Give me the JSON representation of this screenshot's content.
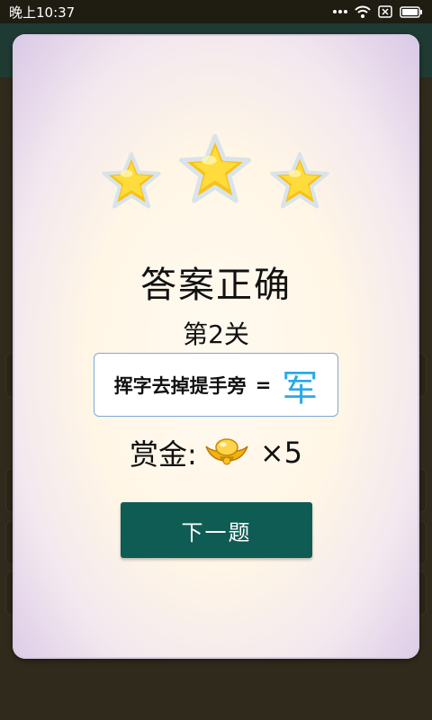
{
  "status_bar": {
    "time": "晚上10:37",
    "icons": [
      "more-dots-icon",
      "wifi-icon",
      "no-sim-icon",
      "battery-icon"
    ]
  },
  "dialog": {
    "stars": {
      "earned": 3,
      "total": 3
    },
    "title": "答案正确",
    "level": "第2关",
    "riddle": {
      "question": "挥字去掉提手旁",
      "equals": "=",
      "answer": "军"
    },
    "reward": {
      "label": "赏金:",
      "icon": "gold-ingot-icon",
      "amount": "×5"
    },
    "next_button": "下一题"
  },
  "colors": {
    "button": "#0f5c55",
    "answer": "#2ba9e6",
    "star": "#f7c21a"
  }
}
